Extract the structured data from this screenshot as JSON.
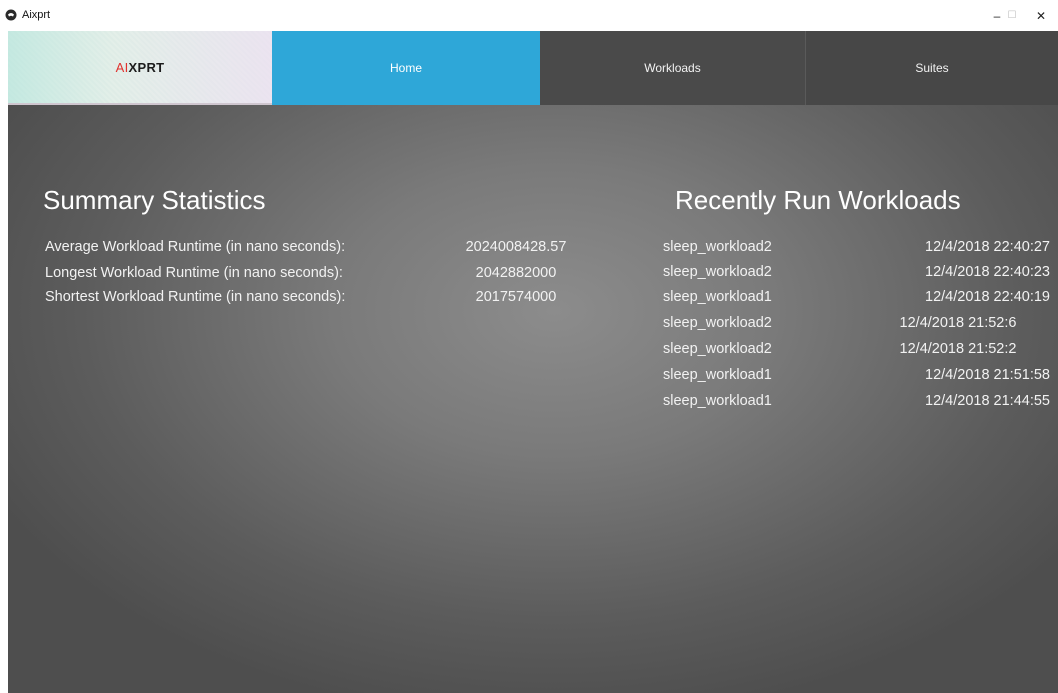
{
  "window": {
    "title": "Aixprt",
    "minimize_glyph": "–",
    "maximize_glyph": "☐",
    "close_glyph": "✕"
  },
  "nav": {
    "logo_part1": "AI",
    "logo_part2": "XPRT",
    "tabs": [
      {
        "label": "Home",
        "active": true
      },
      {
        "label": "Workloads",
        "active": false
      },
      {
        "label": "Suites",
        "active": false
      }
    ]
  },
  "summary": {
    "title": "Summary Statistics",
    "stats": [
      {
        "label": "Average Workload Runtime (in nano seconds):",
        "value": "2024008428.57"
      },
      {
        "label": "Longest Workload Runtime (in nano seconds):",
        "value": "2042882000"
      },
      {
        "label": "Shortest Workload Runtime (in nano seconds):",
        "value": "2017574000"
      }
    ]
  },
  "recent": {
    "title": "Recently Run Workloads",
    "items": [
      {
        "name": "sleep_workload2",
        "time": "12/4/2018 22:40:27"
      },
      {
        "name": "sleep_workload2",
        "time": "12/4/2018 22:40:23"
      },
      {
        "name": "sleep_workload1",
        "time": "12/4/2018 22:40:19"
      },
      {
        "name": "sleep_workload2",
        "time": "12/4/2018 21:52:6"
      },
      {
        "name": "sleep_workload2",
        "time": "12/4/2018 21:52:2"
      },
      {
        "name": "sleep_workload1",
        "time": "12/4/2018 21:51:58"
      },
      {
        "name": "sleep_workload1",
        "time": "12/4/2018 21:44:55"
      }
    ]
  },
  "colors": {
    "active_tab": "#2ea7d8",
    "inactive_tab": "#4a4a4a",
    "logo_accent": "#e0322e"
  }
}
